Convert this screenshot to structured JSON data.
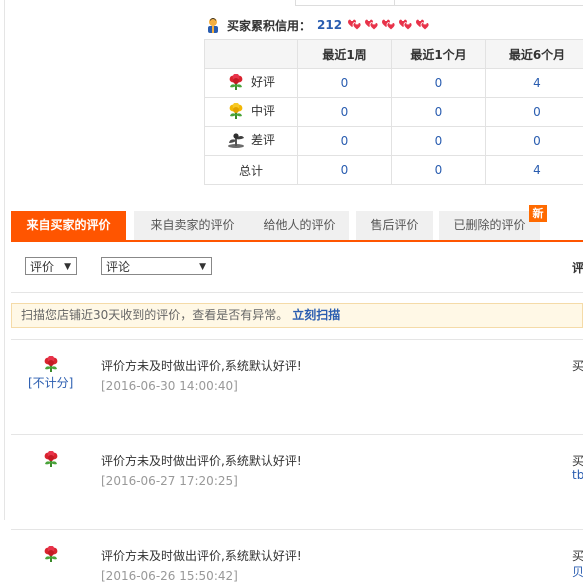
{
  "credit": {
    "label": "买家累积信用：",
    "score": "212",
    "heart_color": "#e8334a",
    "heart_count": 5
  },
  "rating_table": {
    "headers": [
      "最近1周",
      "最近1个月",
      "最近6个月"
    ],
    "rows": [
      {
        "kind": "好评",
        "icon": "red-flower-icon",
        "values": [
          "0",
          "0",
          "4"
        ]
      },
      {
        "kind": "中评",
        "icon": "yellow-flower-icon",
        "values": [
          "0",
          "0",
          "0"
        ]
      },
      {
        "kind": "差评",
        "icon": "wilted-plant-icon",
        "values": [
          "0",
          "0",
          "0"
        ]
      },
      {
        "kind": "总计",
        "icon": "",
        "values": [
          "0",
          "0",
          "4"
        ]
      }
    ]
  },
  "tabs": [
    {
      "label": "来自买家的评价",
      "active": true
    },
    {
      "label": "来自卖家的评价",
      "active": false
    },
    {
      "label": "给他人的评价",
      "active": false
    },
    {
      "label": "售后评价",
      "active": false
    },
    {
      "label": "已删除的评价",
      "active": false
    }
  ],
  "new_badge": "新",
  "filters": {
    "rating_select": "评价",
    "comment_select": "评论",
    "right_column_label": "评"
  },
  "notice": {
    "text": "扫描您店铺近30天收到的评价，查看是否有异常。",
    "link": "立刻扫描"
  },
  "reviews": [
    {
      "text": "评价方未及时做出评价,系统默认好评!",
      "date": "[2016-06-30 14:00:40]",
      "note": "[不计分]",
      "buyer": "买",
      "buyer_link": ""
    },
    {
      "text": "评价方未及时做出评价,系统默认好评!",
      "date": "[2016-06-27 17:20:25]",
      "note": "",
      "buyer": "买",
      "buyer_link": "tb"
    },
    {
      "text": "评价方未及时做出评价,系统默认好评!",
      "date": "[2016-06-26 15:50:42]",
      "note": "",
      "buyer": "买",
      "buyer_link": "贝"
    }
  ],
  "colors": {
    "accent": "#ff5500",
    "link": "#2a5db0",
    "notice_bg": "#fff8e6"
  }
}
